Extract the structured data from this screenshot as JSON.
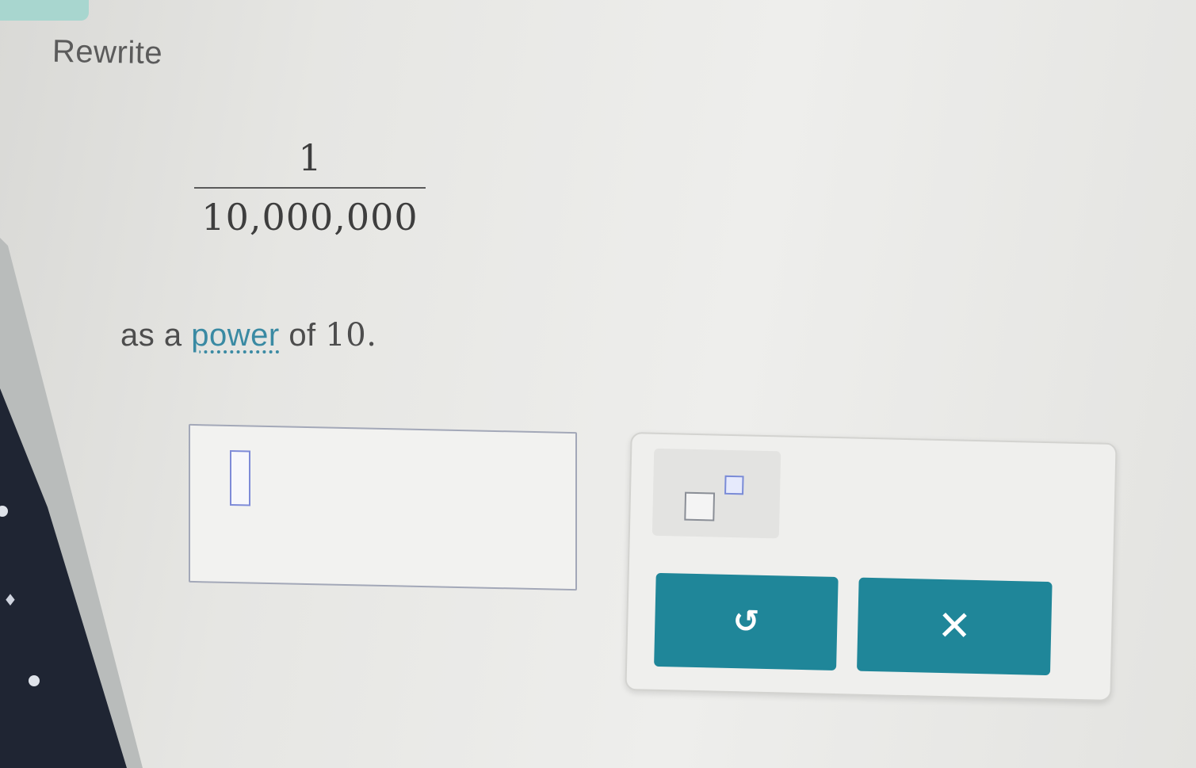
{
  "question": {
    "title": "Rewrite",
    "fraction": {
      "numerator": "1",
      "denominator": "10,000,000"
    },
    "instruction": {
      "prefix": "as a",
      "link_text": "power",
      "suffix": "of",
      "base": "10."
    }
  },
  "answer": {
    "value": ""
  },
  "toolbar": {
    "exponent_icon": "exponent-template-icon",
    "undo_icon": "undo-icon",
    "undo_glyph": "↺",
    "clear_icon": "close-icon",
    "clear_glyph": "✕"
  },
  "colors": {
    "button_teal": "#1f8699",
    "link_blue": "#3a8aa3",
    "tab_mint": "#a8d6cf",
    "input_cursor_blue": "#7e8bd8"
  }
}
